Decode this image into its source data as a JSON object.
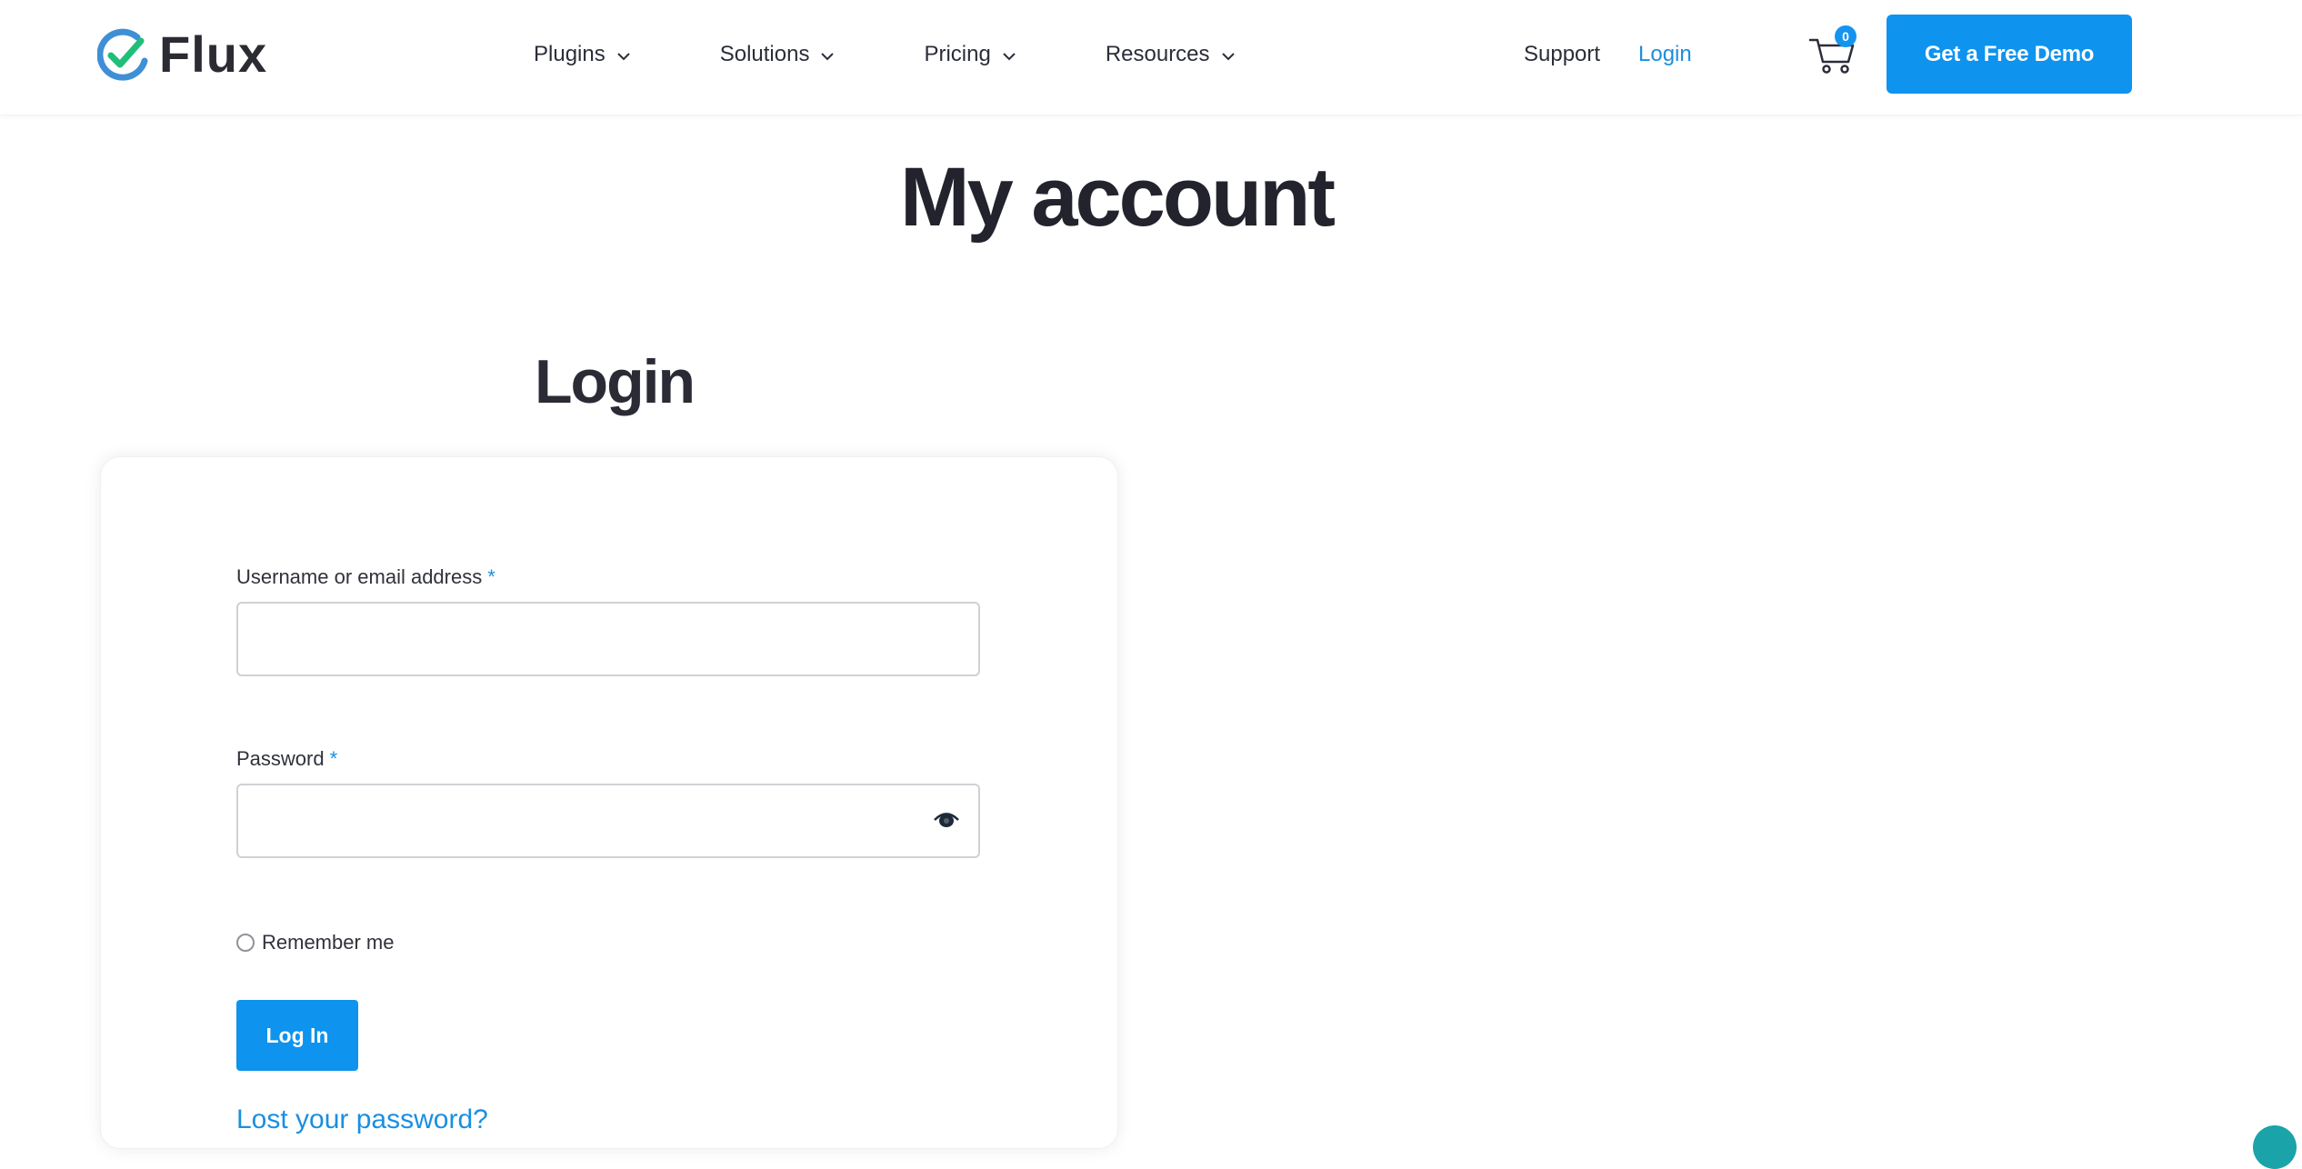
{
  "header": {
    "logo_text": "Flux",
    "nav": [
      {
        "label": "Plugins"
      },
      {
        "label": "Solutions"
      },
      {
        "label": "Pricing"
      },
      {
        "label": "Resources"
      }
    ],
    "support_label": "Support",
    "login_label": "Login",
    "cart_count": "0",
    "demo_label": "Get a Free Demo"
  },
  "main": {
    "page_title": "My account",
    "section_title": "Login",
    "username_label": "Username or email address",
    "password_label": "Password",
    "required_marker": "*",
    "username_value": "",
    "password_value": "",
    "remember_label": "Remember me",
    "login_button": "Log In",
    "lost_password": "Lost your password?"
  },
  "colors": {
    "accent": "#0e93ef",
    "link": "#1a8fe0",
    "heading": "#23232d"
  },
  "icons": {
    "logo": "check-circle-icon",
    "chevron": "chevron-down-icon",
    "cart": "cart-icon",
    "eye": "eye-icon"
  }
}
